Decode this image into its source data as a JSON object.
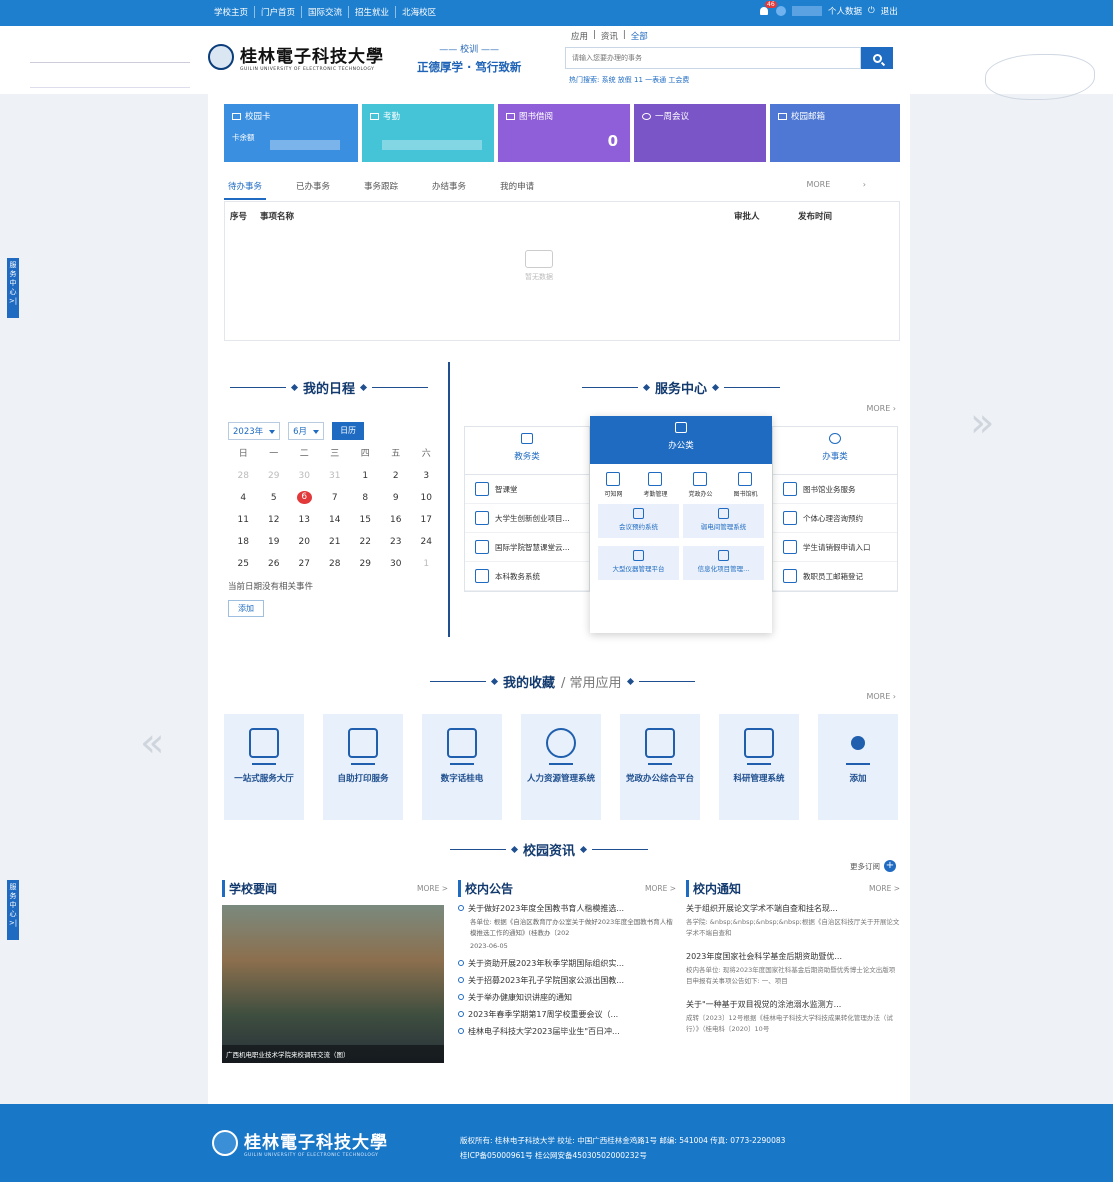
{
  "topbar": {
    "links": [
      "学校主页",
      "门户首页",
      "国际交流",
      "招生就业",
      "北海校区"
    ],
    "badge": "46",
    "personal": "个人数据",
    "logout": "退出"
  },
  "header": {
    "logo_cn": "桂林電子科技大學",
    "logo_en": "GUILIN UNIVERSITY OF ELECTRONIC TECHNOLOGY",
    "motto_title": "校训",
    "motto": "正德厚学 · 笃行致新",
    "search_tabs": [
      "应用",
      "资讯",
      "全部"
    ],
    "search_placeholder": "请输入您要办理的事务",
    "hot": "热门搜索: 系统   放假   11   一表通   工会费"
  },
  "tiles": {
    "campus_card": "校园卡",
    "card_balance": "卡余额",
    "attendance": "考勤",
    "library": "图书借阅",
    "library_count": "0",
    "meeting": "一周会议",
    "mail": "校园邮箱"
  },
  "tasks": {
    "tabs": [
      "待办事务",
      "已办事务",
      "事务跟踪",
      "办结事务",
      "我的申请"
    ],
    "more": "MORE",
    "cols": [
      "序号",
      "事项名称",
      "审批人",
      "发布时间"
    ],
    "empty": "暂无数据"
  },
  "schedule": {
    "title": "我的日程",
    "year": "2023年",
    "month": "6月",
    "btn": "日历",
    "weekdays": [
      "日",
      "一",
      "二",
      "三",
      "四",
      "五",
      "六"
    ],
    "days": [
      "28",
      "29",
      "30",
      "31",
      "1",
      "2",
      "3",
      "4",
      "5",
      "6",
      "7",
      "8",
      "9",
      "10",
      "11",
      "12",
      "13",
      "14",
      "15",
      "16",
      "17",
      "18",
      "19",
      "20",
      "21",
      "22",
      "23",
      "24",
      "25",
      "26",
      "27",
      "28",
      "29",
      "30",
      "1"
    ],
    "no_event": "当前日期没有相关事件",
    "add": "添加"
  },
  "service": {
    "title": "服务中心",
    "more": "MORE",
    "teaching": {
      "label": "教务类",
      "items": [
        "智课堂",
        "大学生创新创业项目...",
        "国际学院智慧课堂云...",
        "本科教务系统"
      ]
    },
    "office": {
      "label": "办公类",
      "grid": [
        "可知网",
        "考勤管理",
        "党政办公",
        "图书馆机"
      ],
      "b1": "会议预约系统",
      "b2": "弱电间管理系统",
      "b3": "大型仪器管理平台",
      "b4": "信息化项目管理..."
    },
    "affairs": {
      "label": "办事类",
      "items": [
        "图书馆业务服务",
        "个体心理咨询预约",
        "学生请销假申请入口",
        "教职员工邮箱登记"
      ]
    }
  },
  "fav": {
    "title": "我的收藏",
    "sub": "常用应用",
    "more": "MORE",
    "items": [
      "一站式服务大厅",
      "自助打印服务",
      "数字话桂电",
      "人力资源管理系统",
      "党政办公综合平台",
      "科研管理系统",
      "添加"
    ]
  },
  "news": {
    "title": "校园资讯",
    "subscribe": "更多订阅",
    "school": {
      "title": "学校要闻",
      "more": "MORE >",
      "caption": "广西机电职业技术学院来校调研交流（图）"
    },
    "notice": {
      "title": "校内公告",
      "more": "MORE >",
      "first": "关于做好2023年度全国教书育人楷模推选...",
      "desc": "各单位: 根据《自治区教育厅办公室关于做好2023年度全国教书育人楷模推选工作的通知》(桂教办〔202",
      "date": "2023-06-05",
      "items": [
        "关于资助开展2023年秋季学期国际组织实...",
        "关于招募2023年孔子学院国家公派出国教...",
        "关于举办健康知识讲座的通知",
        "2023年春季学期第17周学校重要会议（...",
        "桂林电子科技大学2023届毕业生\"百日冲..."
      ]
    },
    "notify": {
      "title": "校内通知",
      "more": "MORE >",
      "items": [
        {
          "t": "关于组织开展论文学术不端自查和挂名现...",
          "d": "各学院: &nbsp;&nbsp;&nbsp;&nbsp;根据《自治区科技厅关于开展论文学术不端自查和"
        },
        {
          "t": "2023年度国家社会科学基金后期资助暨优...",
          "d": "校内各单位: 现将2023年度国家社科基金后期资助暨优秀博士论文出版项目申报有关事项公告如下: 一、项目"
        },
        {
          "t": "关于\"一种基于双目视觉的涂池溺水监测方...",
          "d": "成转〔2023〕12号根据《桂林电子科技大学科技成果转化管理办法（试行）》（桂电科〔2020〕10号"
        }
      ]
    }
  },
  "footer": {
    "line1": "版权所有: 桂林电子科技大学   校址: 中国广西桂林金鸡路1号   邮编: 541004   传真: 0773-2290083",
    "line2": "桂ICP备05000961号 桂公网安备45030502000232号"
  },
  "side": "服务中心 >|"
}
